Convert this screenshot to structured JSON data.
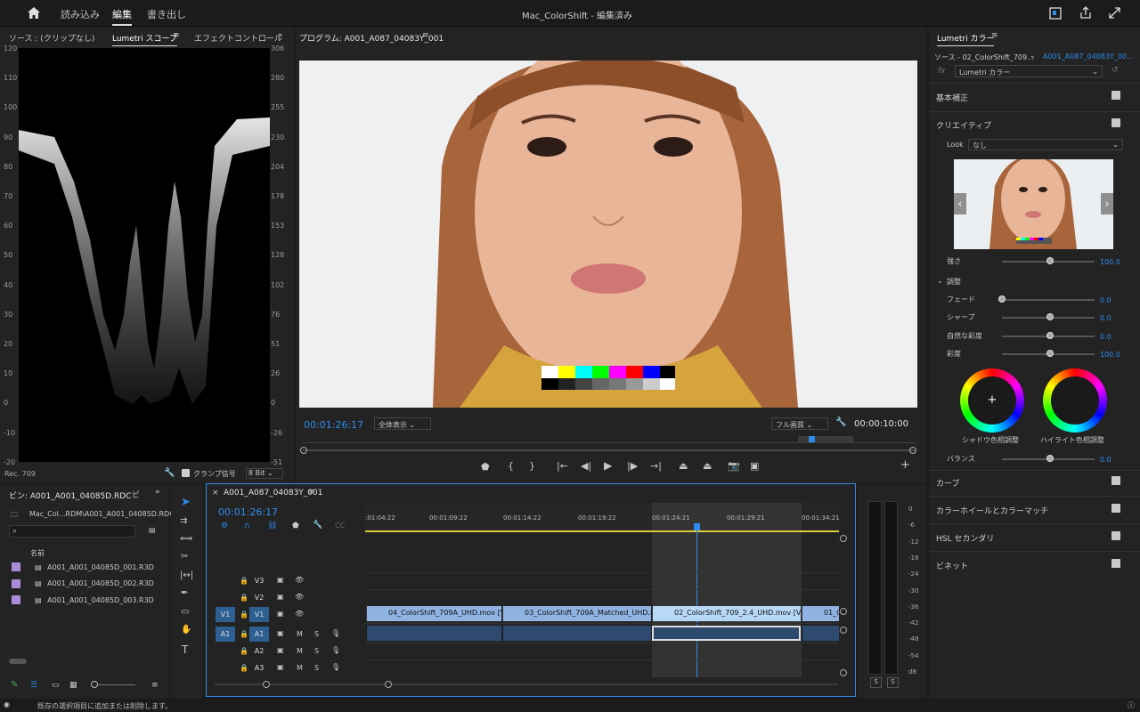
{
  "app": {
    "title": "Mac_ColorShift - 編集済み",
    "nav": [
      "読み込み",
      "編集",
      "書き出し"
    ],
    "active_nav": "編集"
  },
  "source_panel": {
    "tabs": [
      "ソース : (クリップなし)",
      "Lumetri スコープ",
      "エフェクトコントロール"
    ],
    "left_ticks": [
      "120",
      "110",
      "100",
      "90",
      "80",
      "70",
      "60",
      "50",
      "40",
      "30",
      "20",
      "10",
      "0",
      "-10",
      "-20"
    ],
    "right_ticks": [
      "306",
      "280",
      "255",
      "230",
      "204",
      "178",
      "153",
      "128",
      "102",
      "76",
      "51",
      "26",
      "0",
      "-26",
      "-51"
    ],
    "rec": "Rec. 709",
    "clamp_label": "クランプ信号",
    "bit_depth": "8 Bit"
  },
  "program": {
    "title": "プログラム: A001_A087_04083Y_001",
    "timecode": "00:01:26:17",
    "zoom": "全体表示",
    "quality": "フル画質",
    "duration": "00:00:10:00"
  },
  "project": {
    "title": "ビン: A001_A001_04085D.RDC",
    "path": "Mac_Col...RDM\\A001_A001_04085D.RDC",
    "col_name": "名前",
    "files": [
      "A001_A001_04085D_001.R3D",
      "A001_A001_04085D_002.R3D",
      "A001_A001_04085D_003.R3D"
    ]
  },
  "timeline": {
    "title": "A001_A087_04083Y_001",
    "timecode": "00:01:26:17",
    "ruler": [
      ":01:04:22",
      "00:01:09:22",
      "00:01:14:22",
      "00:01:19:22",
      "00:01:24:21",
      "00:01:29:21",
      "00:01:34:21"
    ],
    "tracks": [
      "V3",
      "V2",
      "V1",
      "A1",
      "A2",
      "A3"
    ],
    "src_v": "V1",
    "src_a": "A1",
    "clips": [
      "04_ColorShift_709A_UHD.mov [V]",
      "03_ColorShift_709A_Matched_UHD.mov",
      "02_ColorShift_709_2.4_UHD.mov [V]",
      "01_C"
    ],
    "m": "M",
    "s": "S"
  },
  "meter": {
    "ticks": [
      "0",
      "-6",
      "-12",
      "-18",
      "-24",
      "-30",
      "-36",
      "-42",
      "-48",
      "-54",
      "dB"
    ],
    "solo": "S"
  },
  "lumetri": {
    "title": "Lumetri カラー",
    "source": "ソース - 02_ColorShift_709...",
    "target": "A001_A087_04083Y_00...",
    "fx_name": "Lumetri カラー",
    "sections": {
      "basic": "基本補正",
      "creative": "クリエイティブ",
      "curves": "カーブ",
      "wheels": "カラーホイールとカラーマッチ",
      "hsl": "HSL セカンダリ",
      "vignette": "ビネット"
    },
    "look_label": "Look",
    "look_value": "なし",
    "intensity_label": "強さ",
    "intensity": "100.0",
    "adjust_label": "調整",
    "adjustments": [
      {
        "label": "フェード",
        "value": "0.0",
        "pos": 0.0
      },
      {
        "label": "シャープ",
        "value": "0.0",
        "pos": 0.5
      },
      {
        "label": "自然な彩度",
        "value": "0.0",
        "pos": 0.5
      },
      {
        "label": "彩度",
        "value": "100.0",
        "pos": 0.5
      }
    ],
    "shadow_label": "シャドウ色相調整",
    "highlight_label": "ハイライト色相調整",
    "balance_label": "バランス",
    "balance": "0.0"
  },
  "status": "既存の選択項目に追加または削除します。",
  "colors": {
    "accent": "#2d8ceb",
    "panel": "#232323",
    "clip": "#8fb4e3",
    "audio": "#2e4b6f"
  }
}
